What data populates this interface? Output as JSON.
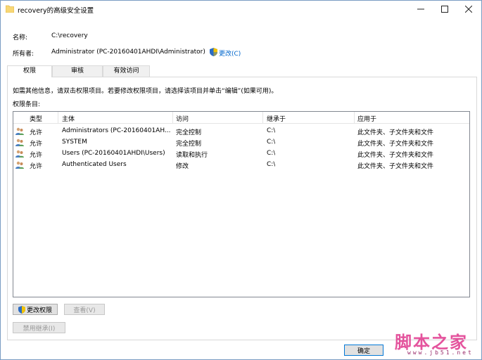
{
  "window": {
    "title": "recovery的高级安全设置"
  },
  "info": {
    "name_label": "名称:",
    "name_value": "C:\\recovery",
    "owner_label": "所有者:",
    "owner_value": "Administrator (PC-20160401AHDI\\Administrator)",
    "owner_change_link": "更改(C)"
  },
  "tabs": [
    {
      "label": "权限",
      "active": true
    },
    {
      "label": "审核",
      "active": false
    },
    {
      "label": "有效访问",
      "active": false
    }
  ],
  "permissions": {
    "instructions": "如需其他信息，请双击权限项目。若要修改权限项目，请选择该项目并单击“编辑”(如果可用)。",
    "entries_label": "权限条目:",
    "columns": [
      "类型",
      "主体",
      "访问",
      "继承于",
      "应用于"
    ],
    "rows": [
      {
        "type": "允许",
        "principal": "Administrators (PC-20160401AH...",
        "access": "完全控制",
        "inherited_from": "C:\\",
        "applies_to": "此文件夹、子文件夹和文件"
      },
      {
        "type": "允许",
        "principal": "SYSTEM",
        "access": "完全控制",
        "inherited_from": "C:\\",
        "applies_to": "此文件夹、子文件夹和文件"
      },
      {
        "type": "允许",
        "principal": "Users (PC-20160401AHDI\\Users)",
        "access": "读取和执行",
        "inherited_from": "C:\\",
        "applies_to": "此文件夹、子文件夹和文件"
      },
      {
        "type": "允许",
        "principal": "Authenticated Users",
        "access": "修改",
        "inherited_from": "C:\\",
        "applies_to": "此文件夹、子文件夹和文件"
      }
    ]
  },
  "buttons": {
    "change_permissions": "更改权限",
    "view": "查看(V)",
    "disable_inheritance": "禁用继承(I)",
    "ok": "确定"
  },
  "watermark": {
    "text": "脚本之家",
    "url": "www.jb51.net"
  },
  "colors": {
    "link": "#0066cc",
    "shield_blue": "#2b6cc4",
    "shield_yellow": "#f2c200",
    "folder": "#f8d775",
    "watermark": "#e0368c"
  }
}
